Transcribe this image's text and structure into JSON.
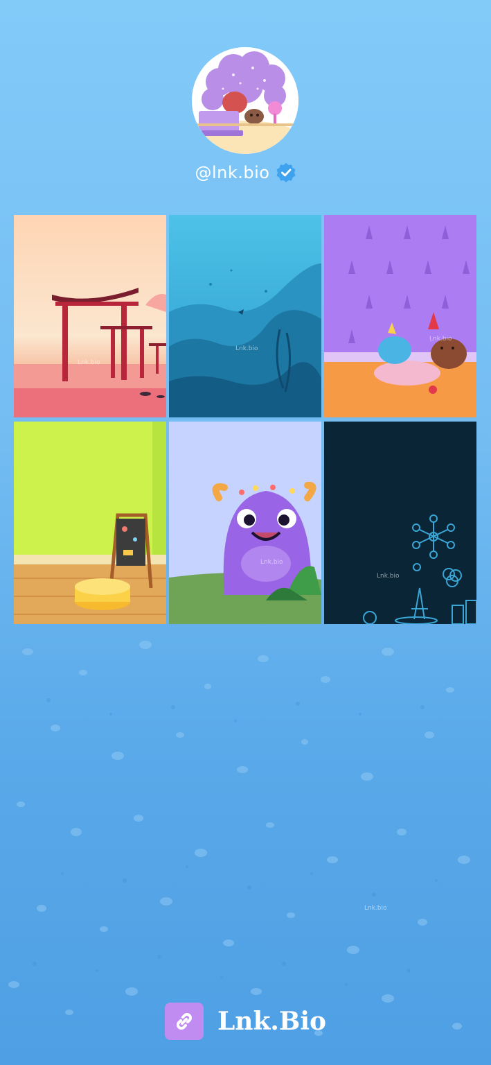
{
  "profile": {
    "handle": "@lnk.bio",
    "verified": true,
    "avatar_icon": "avatar-illustration"
  },
  "gallery": {
    "tiles": [
      {
        "name": "tile-torii-gate",
        "watermark": "Lnk.bio"
      },
      {
        "name": "tile-underwater",
        "watermark": "Lnk.bio"
      },
      {
        "name": "tile-toy-basket",
        "watermark": "Lnk.bio"
      },
      {
        "name": "tile-green-room",
        "watermark": ""
      },
      {
        "name": "tile-purple-monster",
        "watermark": "Lnk.bio"
      },
      {
        "name": "tile-dark-blueprint",
        "watermark": "Lnk.bio"
      }
    ]
  },
  "page_watermark": "Lnk.bio",
  "footer": {
    "brand": "Lnk.Bio",
    "icon": "link-icon"
  },
  "colors": {
    "background_top": "#82caf8",
    "background_bottom": "#4e9fe4",
    "footer_icon_bg": "#c18cf1",
    "verified_badge": "#3ea2ef"
  }
}
